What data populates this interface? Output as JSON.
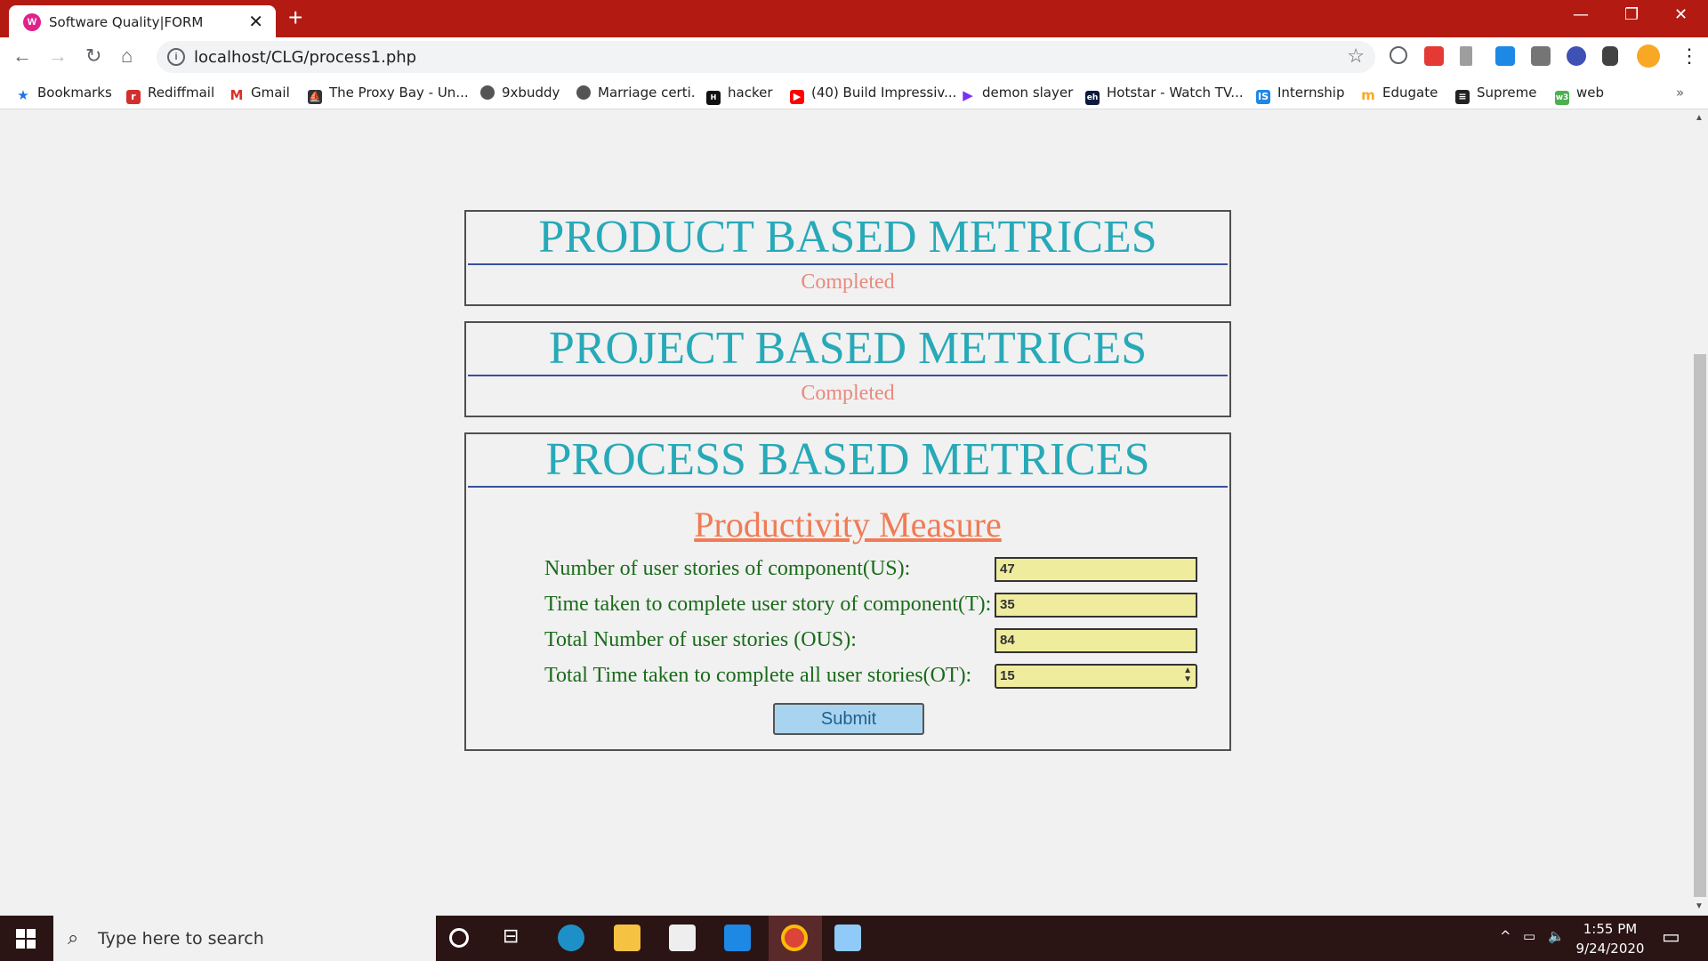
{
  "browser": {
    "tab_title": "Software Quality|FORM",
    "url": "localhost/CLG/process1.php",
    "bookmarks": [
      {
        "label": "Bookmarks"
      },
      {
        "label": "Rediffmail"
      },
      {
        "label": "Gmail"
      },
      {
        "label": "The Proxy Bay - Un..."
      },
      {
        "label": "9xbuddy"
      },
      {
        "label": "Marriage certi."
      },
      {
        "label": "hacker"
      },
      {
        "label": "(40) Build Impressiv..."
      },
      {
        "label": "demon slayer"
      },
      {
        "label": "Hotstar - Watch TV..."
      },
      {
        "label": "Internship"
      },
      {
        "label": "Edugate"
      },
      {
        "label": "Supreme"
      },
      {
        "label": "web"
      }
    ]
  },
  "sections": [
    {
      "title": "PRODUCT BASED METRICES",
      "status": "Completed"
    },
    {
      "title": "PROJECT BASED METRICES",
      "status": "Completed"
    },
    {
      "title": "PROCESS BASED METRICES"
    }
  ],
  "form": {
    "heading": "Productivity Measure",
    "fields": [
      {
        "label": "Number of user stories of component(US):",
        "value": "47"
      },
      {
        "label": "Time taken to complete user story of component(T):",
        "value": "35"
      },
      {
        "label": "Total Number of user stories (OUS):",
        "value": "84"
      },
      {
        "label": "Total Time taken to complete all user stories(OT):",
        "value": "15"
      }
    ],
    "submit_label": "Submit"
  },
  "taskbar": {
    "search_placeholder": "Type here to search",
    "time": "1:55 PM",
    "date": "9/24/2020"
  }
}
